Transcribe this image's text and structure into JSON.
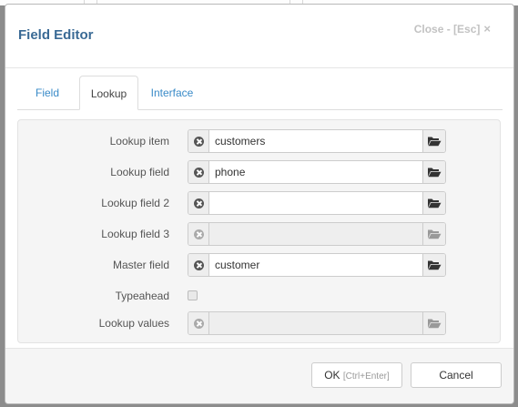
{
  "dialog": {
    "title": "Field Editor",
    "close_label": "Close - [Esc]",
    "close_symbol": "×"
  },
  "tabs": [
    {
      "label": "Field",
      "active": false
    },
    {
      "label": "Lookup",
      "active": true
    },
    {
      "label": "Interface",
      "active": false
    }
  ],
  "form": {
    "lookup_item": {
      "label": "Lookup item",
      "value": "customers",
      "enabled": true
    },
    "lookup_field": {
      "label": "Lookup field",
      "value": "phone",
      "enabled": true
    },
    "lookup_field_2": {
      "label": "Lookup field 2",
      "value": "",
      "enabled": true
    },
    "lookup_field_3": {
      "label": "Lookup field 3",
      "value": "",
      "enabled": false
    },
    "master_field": {
      "label": "Master field",
      "value": "customer",
      "enabled": true
    },
    "typeahead": {
      "label": "Typeahead",
      "checked": false,
      "enabled": false
    },
    "lookup_values": {
      "label": "Lookup values",
      "value": "",
      "enabled": false
    }
  },
  "footer": {
    "ok_label": "OK",
    "ok_shortcut": "[Ctrl+Enter]",
    "cancel_label": "Cancel"
  },
  "icons": {
    "clear": "clear-icon",
    "browse": "folder-open-icon"
  },
  "colors": {
    "title": "#3a6a95",
    "tab_link": "#3a8bc8",
    "overlay": "#8c8c8c"
  }
}
